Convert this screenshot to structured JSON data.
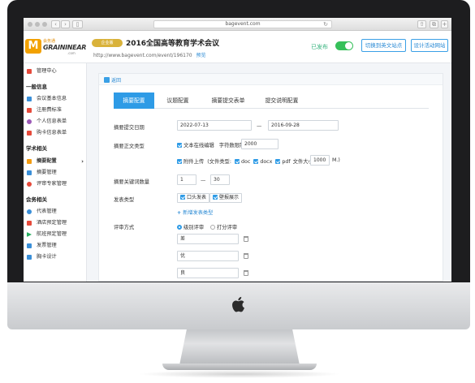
{
  "browser": {
    "url": "bagevent.com"
  },
  "header": {
    "logo_en": "GRAININEAR",
    "logo_cn": "会务通",
    "logo_com": ".com",
    "vip_badge": "企业版",
    "event_title": "2016全国高等教育学术会议",
    "event_url": "http://www.bagevent.com/event/196170",
    "edit_link": "预览",
    "published_label": "已发布",
    "btn_switch": "切换到英文站点",
    "btn_design": "设计活动网站"
  },
  "sidebar": {
    "items": [
      {
        "label": "管理中心",
        "color": "#e64a3b"
      },
      {
        "group": "一般信息"
      },
      {
        "label": "会议基本信息",
        "color": "#3a8fd8"
      },
      {
        "label": "注册费标准",
        "color": "#e64a3b"
      },
      {
        "label": "个人信息表单",
        "color": "#9b59b6"
      },
      {
        "label": "购卡信息表单",
        "color": "#e64a3b"
      },
      {
        "group": "学术相关"
      },
      {
        "label": "摘要配置",
        "color": "#f39c12"
      },
      {
        "label": "摘要管理",
        "color": "#3a8fd8"
      },
      {
        "label": "评审专家管理",
        "color": "#e64a3b"
      },
      {
        "group": "会务相关"
      },
      {
        "label": "代表管理",
        "color": "#3a8fd8"
      },
      {
        "label": "酒店预定管理",
        "color": "#e64a3b"
      },
      {
        "label": "航班预定管理",
        "color": "#27ae60"
      },
      {
        "label": "发票管理",
        "color": "#3a8fd8"
      },
      {
        "label": "胸卡设计",
        "color": "#3a8fd8"
      }
    ]
  },
  "main": {
    "back_label": "返回",
    "tabs": [
      "摘要配置",
      "议题配置",
      "摘要提交表单",
      "提交说明配置"
    ],
    "form": {
      "date_label": "摘要提交日期",
      "date_start": "2022-07-13",
      "date_sep": "—",
      "date_end": "2016-09-28",
      "body_label": "摘要正文类型",
      "text_online": "文本在线编辑",
      "word_limit_label": "字符数限制",
      "word_limit": "2000",
      "attach_label": "附件上传",
      "file_type_label": "(文件类型:",
      "doc": "doc",
      "docx": "docx",
      "pdf": "pdf",
      "file_size_label": "文件大小不超过",
      "file_size": "1000",
      "file_size_unit": "M.)",
      "keywords_label": "摘要关键词数量",
      "kw_min": "1",
      "kw_sep": "—",
      "kw_max": "30",
      "pub_type_label": "发表类型",
      "pub_oral": "口头发表",
      "pub_poster": "壁报展示",
      "add_pub_type": "新增发表类型",
      "review_label": "评审方式",
      "review_grade": "级别评审",
      "review_score": "打分评审",
      "grades": [
        "差",
        "优",
        "良"
      ]
    }
  }
}
